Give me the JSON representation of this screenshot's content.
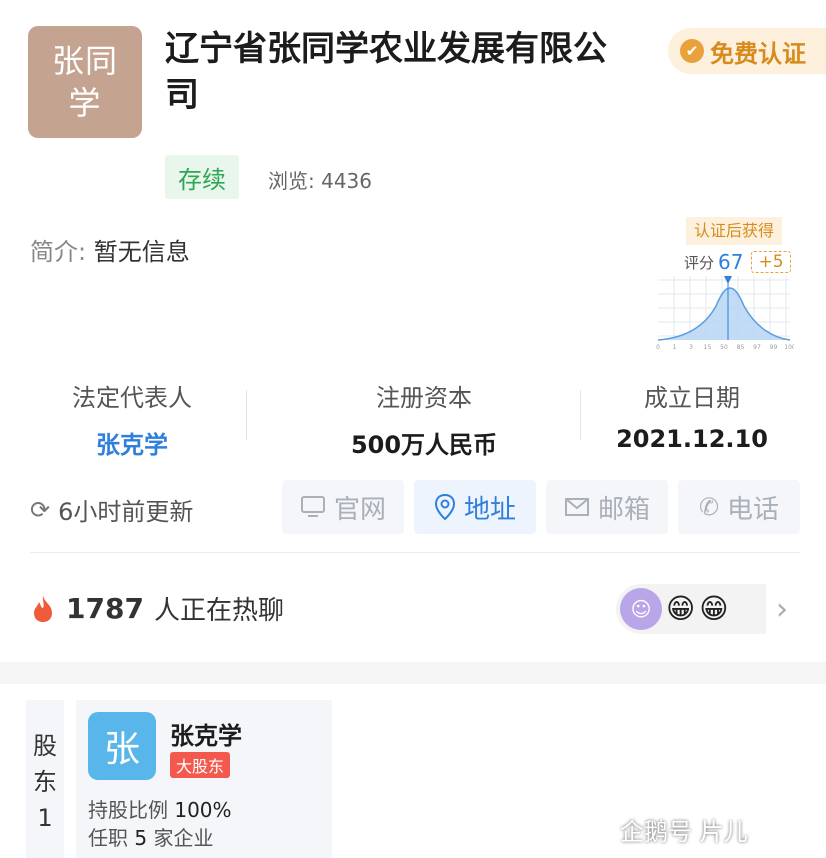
{
  "company": {
    "logo_text": "张同学",
    "name": "辽宁省张同学农业发展有限公司",
    "cert_label": "免费认证",
    "status": "存续",
    "views_label": "浏览:",
    "views": "4436",
    "intro_label": "简介:",
    "intro_value": "暂无信息"
  },
  "score": {
    "badge": "认证后获得",
    "label": "评分",
    "value": "67",
    "bonus": "+5",
    "axis_ticks": [
      "0",
      "1",
      "3",
      "15",
      "50",
      "85",
      "97",
      "99",
      "100"
    ]
  },
  "info": [
    {
      "key": "法定代表人",
      "value": "张克学"
    },
    {
      "key": "注册资本",
      "value": "500万人民币"
    },
    {
      "key": "成立日期",
      "value": "2021.12.10"
    }
  ],
  "actions": {
    "update_text": "6小时前更新",
    "website": "官网",
    "address": "地址",
    "email": "邮箱",
    "phone": "电话"
  },
  "hot": {
    "count": "1787",
    "text": "人正在热聊",
    "emoji1": "😁",
    "emoji2": "😁"
  },
  "shareholder": {
    "side_chars": [
      "股",
      "东",
      "1"
    ],
    "avatar_char": "张",
    "name": "张克学",
    "tag": "大股东",
    "ratio_label": "持股比例",
    "ratio_value": "100%",
    "job_prefix": "任职",
    "job_count": "5",
    "job_suffix": "家企业"
  },
  "watermark": "企鹅号 片儿",
  "colors": {
    "accent": "#2f7fdc",
    "status_green": "#2fa654",
    "cert_orange": "#d88b1d",
    "tag_red": "#f3594f",
    "logo_bg": "#c4a390"
  }
}
